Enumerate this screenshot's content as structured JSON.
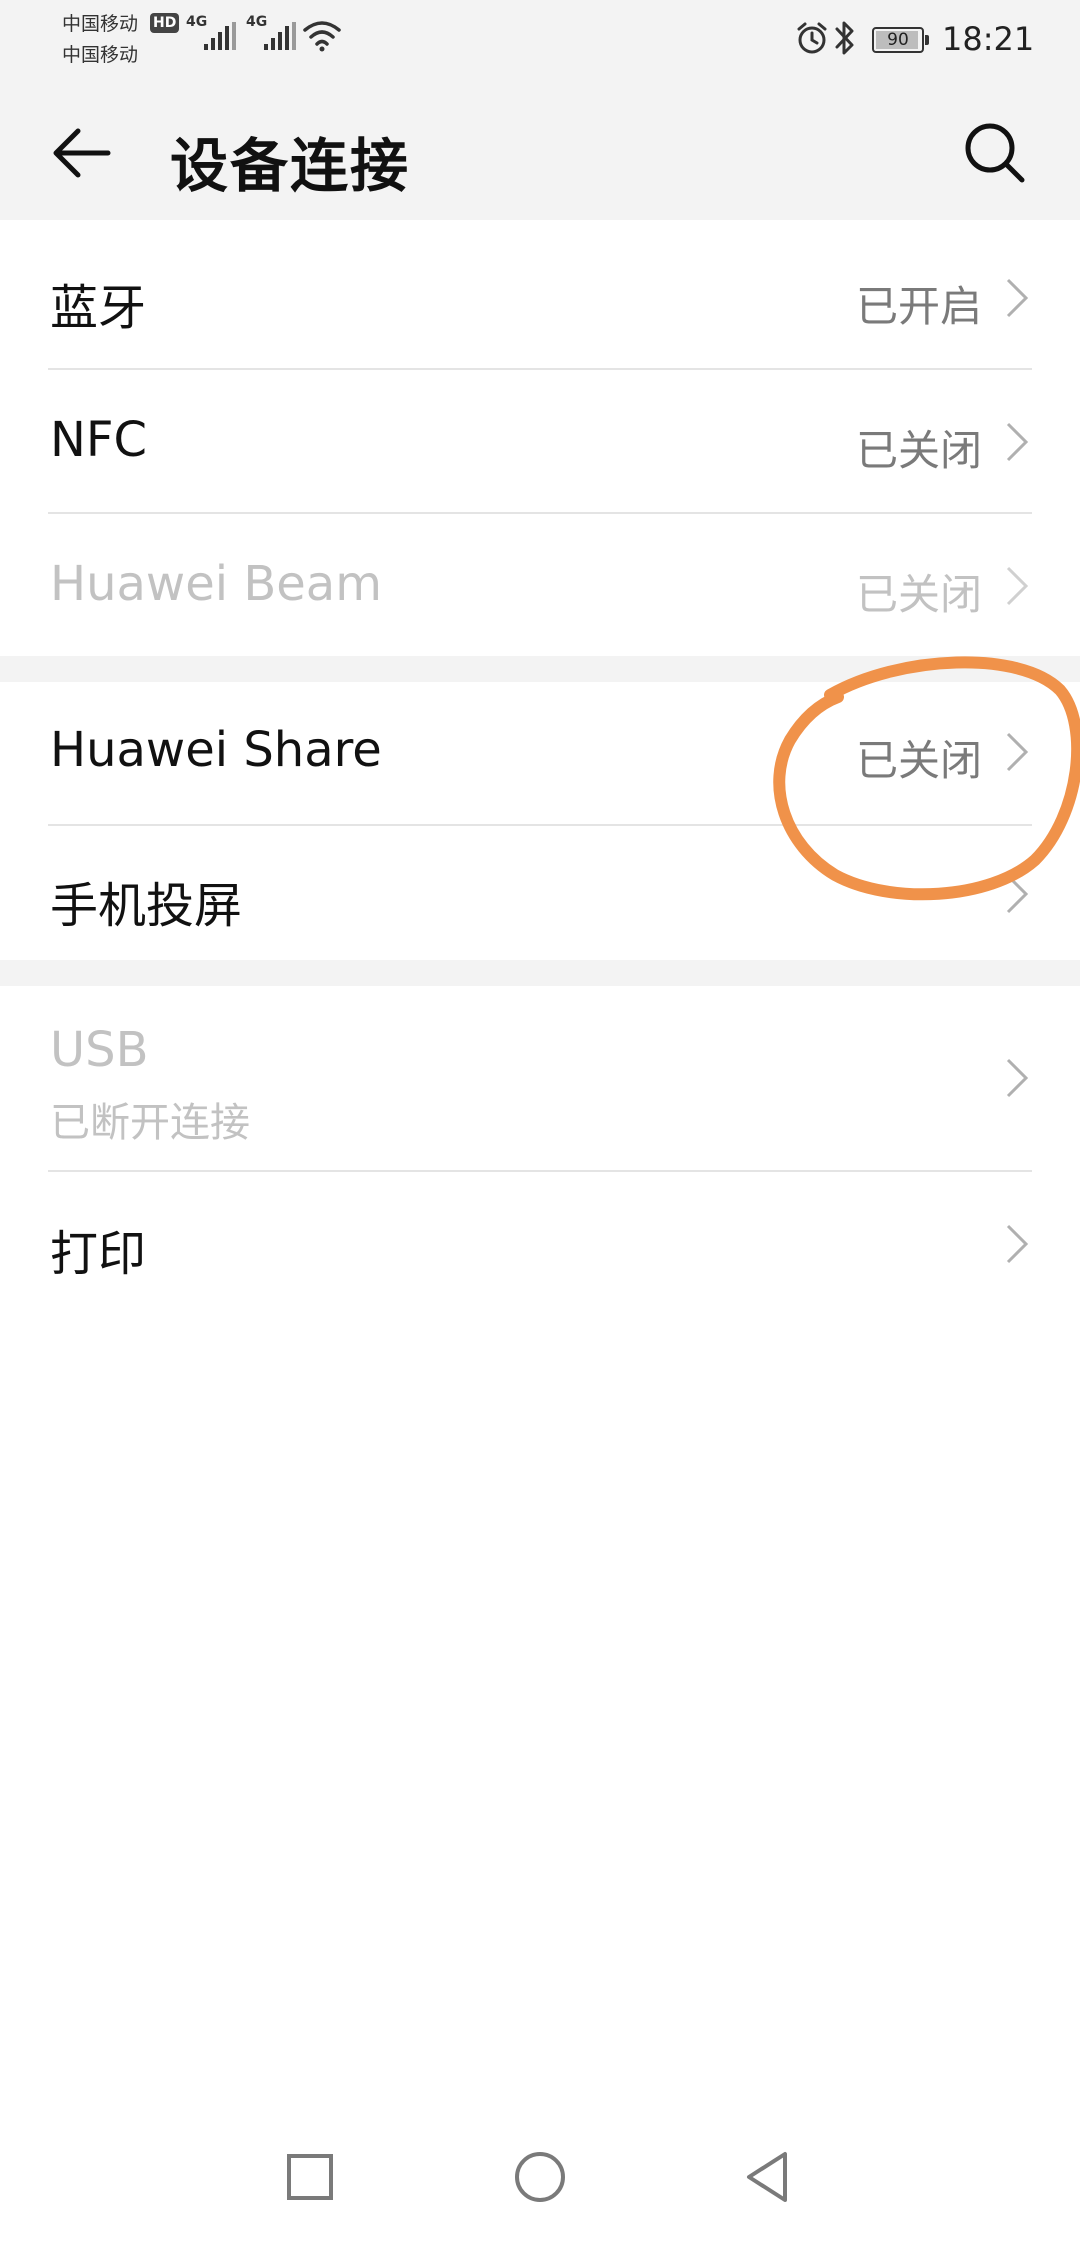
{
  "status_bar": {
    "carrier_1": "中国移动",
    "carrier_2": "中国移动",
    "hd_badge": "HD",
    "signal_1_label": "4G",
    "signal_2_label": "4G",
    "battery_level": "90",
    "time": "18:21",
    "icons": [
      "wifi-icon",
      "alarm-icon",
      "bluetooth-icon"
    ]
  },
  "header": {
    "title": "设备连接",
    "back_icon": "arrow-left-icon",
    "search_icon": "search-icon"
  },
  "settings": {
    "bluetooth": {
      "label": "蓝牙",
      "value": "已开启"
    },
    "nfc": {
      "label": "NFC",
      "value": "已关闭"
    },
    "huawei_beam": {
      "label": "Huawei Beam",
      "value": "已关闭",
      "disabled": true
    },
    "huawei_share": {
      "label": "Huawei Share",
      "value": "已关闭"
    },
    "screen_projection": {
      "label": "手机投屏"
    },
    "usb": {
      "label": "USB",
      "sublabel": "已断开连接",
      "disabled": true
    },
    "print": {
      "label": "打印"
    }
  },
  "annotation": {
    "color": "#f0924a",
    "shape": "hand-drawn circle"
  },
  "nav_bar": {
    "icons": [
      "recents-square-icon",
      "home-circle-icon",
      "back-triangle-icon"
    ]
  },
  "colors": {
    "header_bg": "#f3f3f3",
    "value_text": "#7a7a7a",
    "disabled_text": "#c2c2c2",
    "divider": "#e4e4e4"
  }
}
